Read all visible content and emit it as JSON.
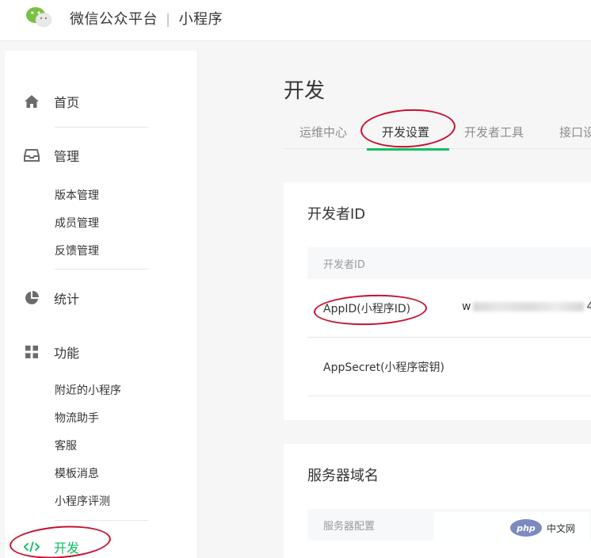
{
  "header": {
    "platform": "微信公众平台",
    "separator": "|",
    "product": "小程序"
  },
  "sidebar": {
    "home": {
      "label": "首页",
      "icon": "home-icon"
    },
    "manage": {
      "label": "管理",
      "icon": "inbox-icon",
      "items": [
        "版本管理",
        "成员管理",
        "反馈管理"
      ]
    },
    "stats": {
      "label": "统计",
      "icon": "pie-chart-icon"
    },
    "features": {
      "label": "功能",
      "icon": "grid-icon",
      "items": [
        "附近的小程序",
        "物流助手",
        "客服",
        "模板消息",
        "小程序评测"
      ]
    },
    "dev": {
      "label": "开发",
      "icon": "code-icon"
    }
  },
  "main": {
    "title": "开发",
    "tabs": [
      "运维中心",
      "开发设置",
      "开发者工具",
      "接口设"
    ],
    "active_tab": "开发设置",
    "developer_id": {
      "title": "开发者ID",
      "table_header": "开发者ID",
      "rows": [
        {
          "label": "AppID(小程序ID)",
          "value_prefix": "w",
          "value_suffix": "4"
        },
        {
          "label": "AppSecret(小程序密钥)",
          "value_prefix": "",
          "value_suffix": ""
        }
      ]
    },
    "server_domain": {
      "title": "服务器域名",
      "table_header": "服务器配置"
    }
  },
  "watermark": {
    "badge": "php",
    "text": "中文网"
  },
  "colors": {
    "accent": "#07c160",
    "annotation": "#c8102e",
    "text": "#353535",
    "muted": "#8d8d8d"
  }
}
